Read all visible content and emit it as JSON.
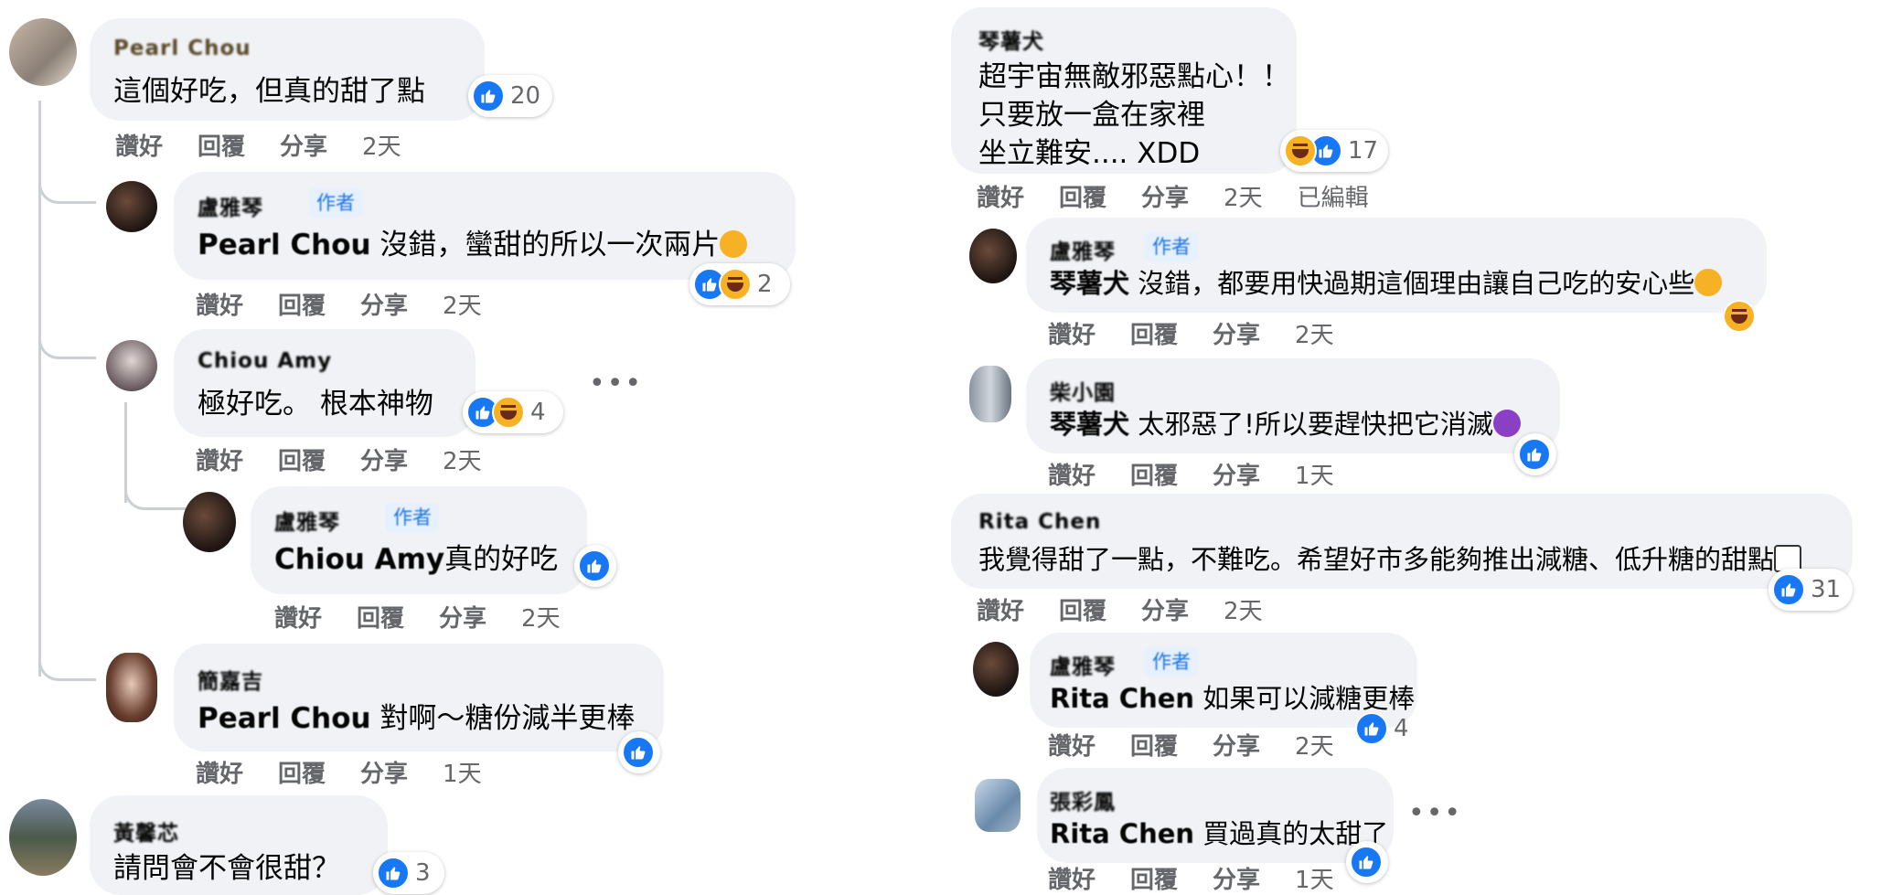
{
  "actions": {
    "like": "讚好",
    "reply": "回覆",
    "share": "分享",
    "edited": "已編輯"
  },
  "author_badge": "作者",
  "left": [
    {
      "name": "Pearl Chou",
      "text": "這個好吃，但真的甜了點",
      "reactions": "20",
      "time": "2天"
    },
    {
      "name": "盧雅琴",
      "mention": "Pearl Chou",
      "text": "沒錯，蠻甜的所以一次兩片",
      "reactions": "2",
      "time": "2天"
    },
    {
      "name": "Chiou Amy",
      "text": "極好吃。 根本神物",
      "reactions": "4",
      "time": "2天"
    },
    {
      "name": "盧雅琴",
      "mention": "Chiou Amy",
      "text": "真的好吃",
      "time": "2天"
    },
    {
      "name": "簡嘉吉",
      "mention": "Pearl Chou",
      "text": "對啊～糖份減半更棒",
      "time": "1天"
    },
    {
      "name": "黃馨芯",
      "text": "請問會不會很甜？",
      "reactions": "3"
    }
  ],
  "right": [
    {
      "name": "琴薯犬",
      "lines": [
        "超宇宙無敵邪惡點心！！",
        "只要放一盒在家裡",
        "坐立難安.... XDD"
      ],
      "reactions": "17",
      "time": "2天"
    },
    {
      "name": "盧雅琴",
      "mention": "琴薯犬",
      "text": "沒錯，都要用快過期這個理由讓自己吃的安心些",
      "time": "2天"
    },
    {
      "name": "柴小園",
      "mention": "琴薯犬",
      "text": "太邪惡了!所以要趕快把它消滅",
      "time": "1天"
    },
    {
      "name": "Rita Chen",
      "text": "我覺得甜了一點，不難吃。希望好市多能夠推出減糖、低升糖的甜點",
      "reactions": "31",
      "time": "2天"
    },
    {
      "name": "盧雅琴",
      "mention": "Rita Chen",
      "text": "如果可以減糖更棒",
      "reactions": "4",
      "time": "2天"
    },
    {
      "name": "張彩鳳",
      "mention": "Rita Chen",
      "text": "買過真的太甜了",
      "time": "1天"
    }
  ],
  "colors": {
    "bubble": "#f0f2f5",
    "like_blue": "#1877f2",
    "meta_gray": "#65676b"
  }
}
